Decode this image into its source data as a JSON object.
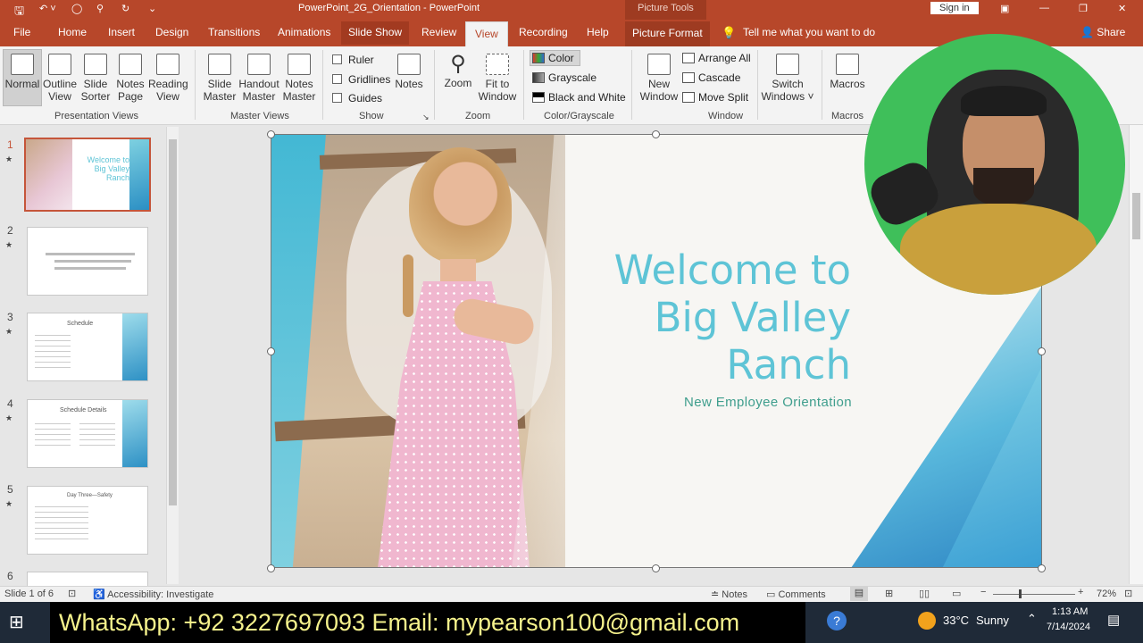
{
  "titlebar": {
    "doc_title": "PowerPoint_2G_Orientation - PowerPoint",
    "context_label": "Picture Tools",
    "signin": "Sign in"
  },
  "tabs": {
    "file": "File",
    "home": "Home",
    "insert": "Insert",
    "design": "Design",
    "transitions": "Transitions",
    "animations": "Animations",
    "slideshow": "Slide Show",
    "review": "Review",
    "view": "View",
    "recording": "Recording",
    "help": "Help",
    "picture_format": "Picture Format",
    "tellme": "Tell me what you want to do",
    "share": "Share"
  },
  "ribbon": {
    "normal": "Normal",
    "outline_1": "Outline",
    "outline_2": "View",
    "sorter_1": "Slide",
    "sorter_2": "Sorter",
    "notespage_1": "Notes",
    "notespage_2": "Page",
    "reading_1": "Reading",
    "reading_2": "View",
    "grp_presentation": "Presentation Views",
    "slidemaster_1": "Slide",
    "slidemaster_2": "Master",
    "handout_1": "Handout",
    "handout_2": "Master",
    "notesmaster_1": "Notes",
    "notesmaster_2": "Master",
    "grp_master": "Master Views",
    "ruler": "Ruler",
    "gridlines": "Gridlines",
    "guides": "Guides",
    "notes": "Notes",
    "grp_show": "Show",
    "zoom": "Zoom",
    "fit_1": "Fit to",
    "fit_2": "Window",
    "grp_zoom": "Zoom",
    "color": "Color",
    "grayscale": "Grayscale",
    "bw": "Black and White",
    "grp_color": "Color/Grayscale",
    "newwin_1": "New",
    "newwin_2": "Window",
    "arrange": "Arrange All",
    "cascade": "Cascade",
    "movesplit": "Move Split",
    "grp_window": "Window",
    "switch_1": "Switch",
    "switch_2": "Windows ˅",
    "macros": "Macros",
    "grp_macros": "Macros"
  },
  "thumbs": {
    "n1": "1",
    "n2": "2",
    "n3": "3",
    "n4": "4",
    "n5": "5",
    "n6": "6",
    "s1_title": "Welcome to Big Valley Ranch",
    "s3_title": "Schedule",
    "s4_title": "Schedule Details",
    "s5_title": "Day Three—Safety"
  },
  "slide": {
    "title_1": "Welcome to",
    "title_2": "Big Valley",
    "title_3": "Ranch",
    "subtitle": "New Employee Orientation"
  },
  "status": {
    "slide_of": "Slide 1 of 6",
    "accessibility": "Accessibility: Investigate",
    "notes": "Notes",
    "comments": "Comments",
    "zoom": "72%"
  },
  "taskbar": {
    "banner": "WhatsApp: +92 3227697093  Email: mypearson100@gmail.com",
    "temp": "33°C",
    "weather": "Sunny",
    "time": "1:13 AM",
    "date": "7/14/2024"
  },
  "colors": {
    "accent": "#b7472a",
    "slide_title": "#5ec4d6",
    "slide_subtitle": "#3f9e8d"
  }
}
